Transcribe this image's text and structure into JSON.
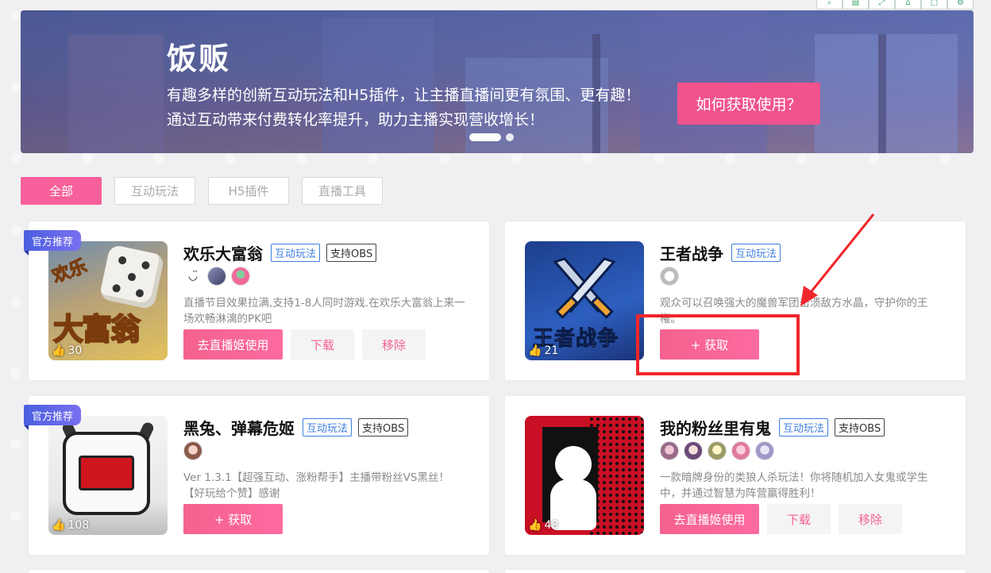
{
  "toolbar": {
    "icons": [
      "search-icon",
      "document-icon",
      "expand-icon",
      "home-icon",
      "window-icon",
      "settings-icon"
    ]
  },
  "banner": {
    "title": "饭贩",
    "description": "有趣多样的创新互动玩法和H5插件，让主播直播间更有氛围、更有趣！通过互动带来付费转化率提升，助力主播实现营收增长！",
    "cta": "如何获取使用？",
    "carousel": {
      "total": 2,
      "active": 1
    }
  },
  "filters": {
    "tabs": [
      "全部",
      "互动玩法",
      "H5插件",
      "直播工具"
    ],
    "active": "全部"
  },
  "cards": [
    {
      "badge": "官方推荐",
      "title": "欢乐大富翁",
      "tags": [
        "互动玩法",
        "支持OBS"
      ],
      "likes": "30",
      "description": "直播节目效果拉满,支持1-8人同时游戏.在欢乐大富翁上来一场欢畅淋漓的PK吧",
      "buttons": [
        "去直播姬使用",
        "下载",
        "移除"
      ],
      "avatar_count": 3
    },
    {
      "badge": "",
      "title": "王者战争",
      "tags": [
        "互动玩法"
      ],
      "likes": "21",
      "description": "观众可以召唤强大的魔兽军团击溃敌方水晶，守护你的王権。",
      "buttons": [
        "+ 获取"
      ],
      "avatar_count": 1
    },
    {
      "badge": "官方推荐",
      "title": "黑兔、弹幕危姬",
      "tags": [
        "互动玩法",
        "支持OBS"
      ],
      "likes": "108",
      "description": "Ver 1.3.1【超强互动、涨粉帮手】主播带粉丝VS黑丝！【好玩给个赞】感谢",
      "buttons": [
        "+ 获取"
      ],
      "avatar_count": 1
    },
    {
      "badge": "",
      "title": "我的粉丝里有鬼",
      "tags": [
        "互动玩法",
        "支持OBS"
      ],
      "likes": "48",
      "description": "一款暗牌身份的类狼人杀玩法！你将随机加入女鬼或学生中，并通过智慧为阵营赢得胜利！",
      "buttons": [
        "去直播姬使用",
        "下载",
        "移除"
      ],
      "avatar_count": 5
    }
  ],
  "colors": {
    "accent": "#f7609a",
    "tag_blue": "#3c7fe0",
    "badge": "#4b5fe0",
    "annotation_red": "#f0262c"
  }
}
